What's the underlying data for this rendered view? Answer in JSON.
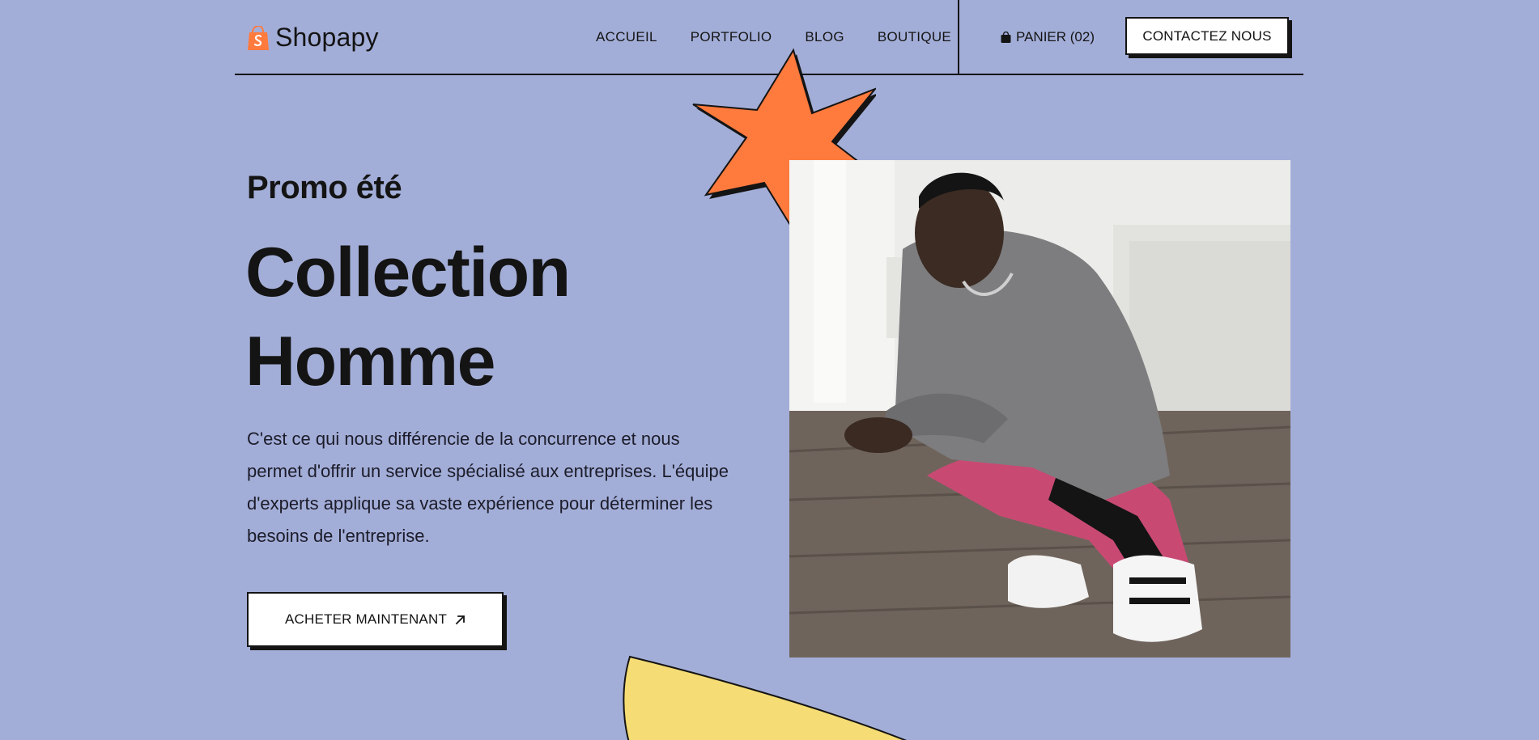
{
  "brand": {
    "name": "Shopapy",
    "logo_icon": "shopping-bag-logo-icon",
    "accent_color": "#ff7a3d"
  },
  "nav": {
    "items": [
      {
        "label": "ACCUEIL"
      },
      {
        "label": "PORTFOLIO"
      },
      {
        "label": "BLOG"
      },
      {
        "label": "BOUTIQUE"
      }
    ]
  },
  "cart": {
    "label": "PANIER (02)",
    "icon": "shopping-bag-icon"
  },
  "contact": {
    "label": "CONTACTEZ NOUS"
  },
  "hero": {
    "promo": "Promo été",
    "title_line1": "Collection",
    "title_line2": "Homme",
    "description": "C'est ce qui nous différencie de la concurrence et nous permet d'offrir un service spécialisé aux entreprises. L'équipe d'experts applique sa vaste expérience pour déterminer les besoins de l'entreprise.",
    "cta_label": "ACHETER MAINTENANT",
    "cta_icon": "arrow-up-right-icon"
  },
  "colors": {
    "background": "#a3aed8",
    "star": "#ff7a3d",
    "yellow": "#f5dc74",
    "ink": "#141414"
  }
}
